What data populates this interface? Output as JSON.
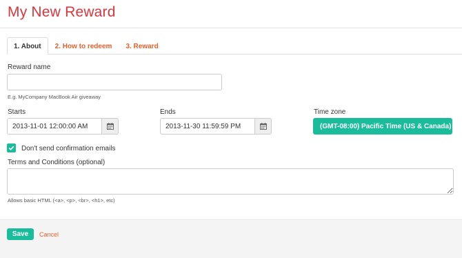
{
  "page": {
    "title": "My New Reward"
  },
  "tabs": [
    {
      "label": "1. About",
      "active": true
    },
    {
      "label": "2. How to redeem",
      "active": false
    },
    {
      "label": "3. Reward",
      "active": false
    }
  ],
  "form": {
    "reward_name": {
      "label": "Reward name",
      "value": "",
      "help": "E.g. MyCompany MacBook Air giveaway"
    },
    "starts": {
      "label": "Starts",
      "value": "2013-11-01 12:00:00 AM"
    },
    "ends": {
      "label": "Ends",
      "value": "2013-11-30 11:59:59 PM"
    },
    "timezone": {
      "label": "Time zone",
      "value": "(GMT-08:00) Pacific Time (US & Canada)"
    },
    "no_confirm": {
      "label": "Don't send confirmation emails",
      "checked": true
    },
    "terms": {
      "label": "Terms and Conditions (optional)",
      "value": "",
      "help": "Allows basic HTML (<a>, <p>, <br>, <h1>, etc)"
    }
  },
  "footer": {
    "save_label": "Save",
    "cancel_label": "Cancel"
  },
  "colors": {
    "title": "#d9363e",
    "accent": "#1abc9c",
    "link": "#e8602c"
  },
  "icons": {
    "calendar": "calendar-icon",
    "check": "check-icon",
    "resize": "resize-grip-icon"
  }
}
